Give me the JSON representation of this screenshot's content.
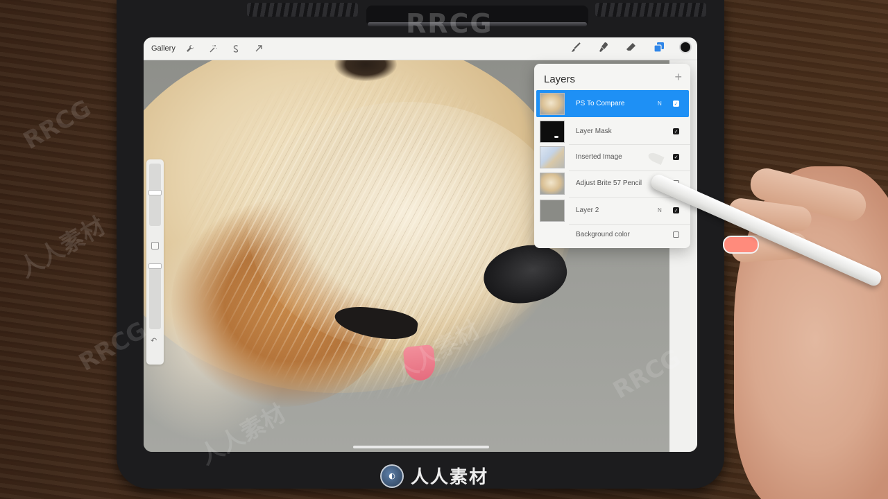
{
  "toolbar": {
    "gallery_label": "Gallery",
    "left_icons": [
      "wrench-icon",
      "magic-wand-icon",
      "selection-icon",
      "transform-icon"
    ],
    "right_icons": [
      "brush-icon",
      "smudge-icon",
      "eraser-icon",
      "layers-icon"
    ],
    "active_tool": "layers-icon",
    "current_color": "#111111"
  },
  "layers_panel": {
    "title": "Layers",
    "add_symbol": "+",
    "accent_color": "#1e90f5",
    "layers": [
      {
        "name": "PS To Compare",
        "mode": "N",
        "visible": true,
        "selected": true
      },
      {
        "name": "Layer Mask",
        "mode": "",
        "visible": true,
        "selected": false
      },
      {
        "name": "Inserted Image",
        "mode": "",
        "visible": true,
        "selected": false
      },
      {
        "name": "Adjust Brite 57 Pencil",
        "mode": "N",
        "visible": false,
        "selected": false
      },
      {
        "name": "Layer 2",
        "mode": "N",
        "visible": true,
        "selected": false
      },
      {
        "name": "Background color",
        "mode": "",
        "visible": false,
        "selected": false
      }
    ]
  },
  "sidebar": {
    "undo_symbol": "↶"
  },
  "watermark": {
    "top_text": "RRCG",
    "bottom_text": "人人素材",
    "diagonal_texts": [
      "RRCG",
      "人人素材",
      "RRCG",
      "人人素材",
      "RRCG",
      "人人素材"
    ]
  }
}
